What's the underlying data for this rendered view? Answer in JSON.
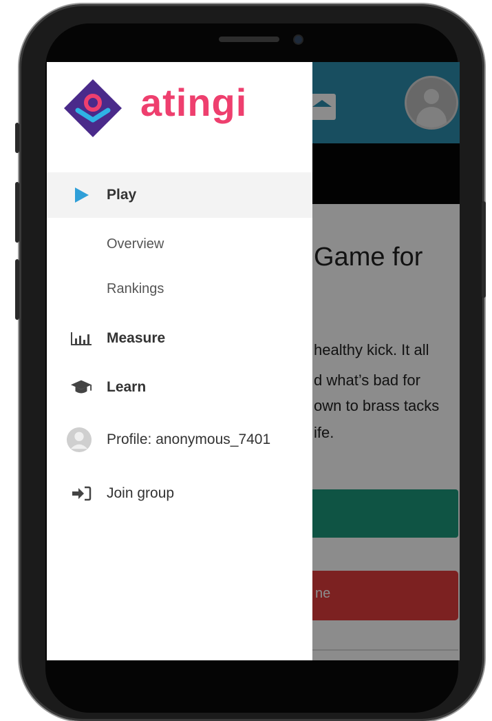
{
  "brand": {
    "name": "atingi"
  },
  "background_app": {
    "title": "Game for",
    "paragraph": [
      "healthy kick. It all",
      "d what’s bad for",
      "own to brass tacks",
      "ife."
    ],
    "red_button_text": "ne"
  },
  "drawer": {
    "items": [
      {
        "label": "Play",
        "icon": "play-icon",
        "active": true
      },
      {
        "label": "Overview",
        "sub": true
      },
      {
        "label": "Rankings",
        "sub": true
      },
      {
        "label": "Measure",
        "icon": "bar-chart-icon"
      },
      {
        "label": "Learn",
        "icon": "graduation-cap-icon"
      },
      {
        "label": "Profile: anonymous_7401",
        "icon": "avatar-icon"
      },
      {
        "label": "Join group",
        "icon": "sign-in-icon"
      }
    ]
  },
  "colors": {
    "brand_pink": "#ee3f6e",
    "brand_purple": "#4a2a8a",
    "play_blue": "#2f9fd8",
    "header_blue": "#2c8fb0",
    "green_button": "#1d9a7d",
    "red_button": "#e23d3d"
  }
}
